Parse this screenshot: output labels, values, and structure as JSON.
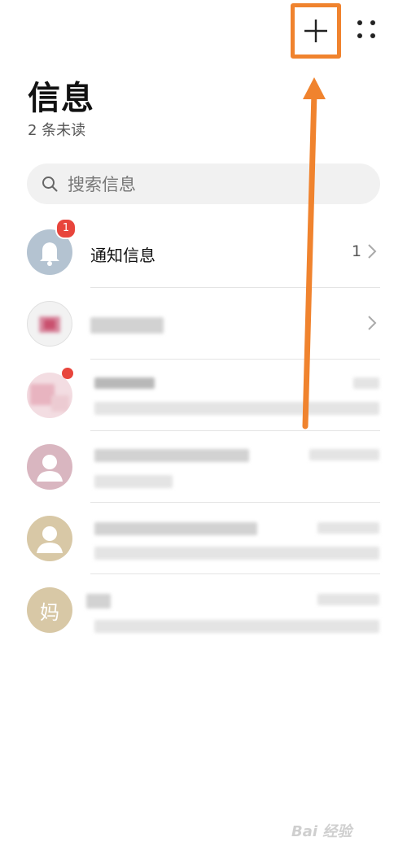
{
  "header": {
    "add_icon": "plus-icon",
    "more_icon": "more-dots-icon",
    "highlight_color": "#f0832e"
  },
  "page": {
    "title": "信息",
    "unread": "2 条未读"
  },
  "search": {
    "placeholder": "搜索信息",
    "icon": "search-icon"
  },
  "conversations": [
    {
      "title": "通知信息",
      "count": "1",
      "badge": "1",
      "avatar_icon": "bell-icon",
      "avatar_color": "#b4c3d1"
    },
    {
      "title": "",
      "obscured": true
    },
    {
      "title": "",
      "obscured": true,
      "unread_dot": true
    },
    {
      "title": "",
      "obscured": true,
      "avatar_icon": "person-icon",
      "avatar_color": "#d9b6c0"
    },
    {
      "title": "",
      "obscured": true,
      "avatar_icon": "person-icon",
      "avatar_color": "#d8c8a6"
    },
    {
      "title": "",
      "obscured": true,
      "avatar_text": "妈",
      "avatar_color": "#d8c8a6"
    }
  ],
  "annotation": {
    "arrow_color": "#f0832e"
  },
  "watermark": {
    "text": "Bai 经验"
  }
}
